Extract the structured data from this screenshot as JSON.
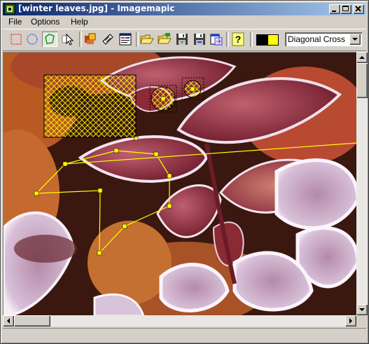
{
  "window": {
    "title": "[winter leaves.jpg] - Imagemapic",
    "caption_buttons": [
      "minimize",
      "maximize",
      "close"
    ]
  },
  "menu": {
    "items": [
      "File",
      "Options",
      "Help"
    ]
  },
  "toolbar": {
    "tools": [
      {
        "name": "rectangle-tool",
        "icon": "rect-dashed-icon",
        "pressed": false
      },
      {
        "name": "circle-tool",
        "icon": "circle-dashed-icon",
        "pressed": false
      },
      {
        "name": "polygon-tool",
        "icon": "polygon-icon",
        "pressed": true
      },
      {
        "name": "pointer-tool",
        "icon": "cursor-icon",
        "pressed": false
      }
    ],
    "actions": [
      "properties-icon",
      "edit-icon",
      "html-icon",
      "open-folder-icon",
      "open-folder-green-icon",
      "save-disk-icon",
      "save-as-disk-icon",
      "export-icon",
      "help-icon"
    ],
    "colors": {
      "foreground": "#000000",
      "background": "#ffff00"
    },
    "fill_pattern": {
      "selected": "Diagonal Cross"
    }
  },
  "colors": {
    "title_gradient_start": "#0a246a",
    "title_gradient_end": "#a6caf0",
    "outline": "#ffff00",
    "face": "#d4d0c8"
  },
  "image": {
    "content": "frosted red leaves",
    "areas": [
      {
        "shape": "rect",
        "fill": "diagonal-cross"
      },
      {
        "shape": "circle",
        "fill": "diagonal-cross"
      },
      {
        "shape": "circle",
        "fill": "diagonal-cross"
      },
      {
        "shape": "polygon",
        "fill": "none"
      },
      {
        "shape": "line",
        "fill": "none"
      }
    ]
  }
}
